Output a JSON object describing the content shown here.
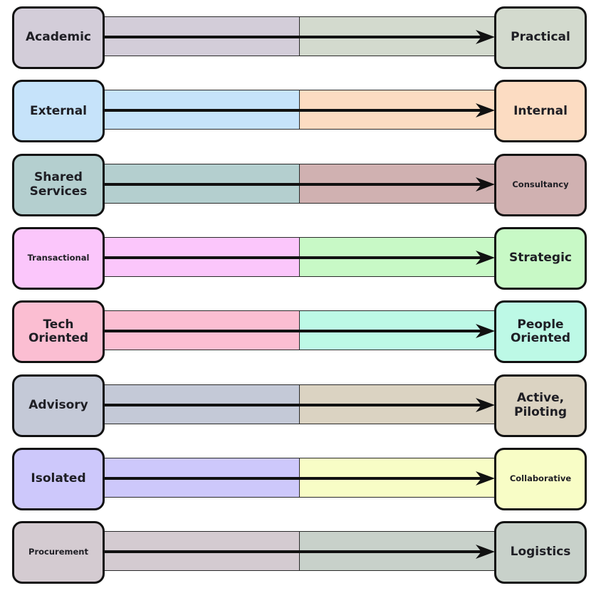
{
  "diagram": {
    "title": "",
    "spectra": [
      {
        "from": "Academic",
        "to": "Practical",
        "from_color": "#d3cdd9",
        "to_color": "#d3dace",
        "from_size": "lg",
        "to_size": "lg"
      },
      {
        "from": "External",
        "to": "Internal",
        "from_color": "#c6e3fa",
        "to_color": "#fcdcc2",
        "from_size": "lg",
        "to_size": "lg"
      },
      {
        "from": "Shared Services",
        "to": "Consultancy",
        "from_color": "#b4cfcf",
        "to_color": "#d0b1b1",
        "from_size": "lg",
        "to_size": "sm"
      },
      {
        "from": "Transactional",
        "to": "Strategic",
        "from_color": "#fbc6fb",
        "to_color": "#c8f9c6",
        "from_size": "sm",
        "to_size": "lg"
      },
      {
        "from": "Tech Oriented",
        "to": "People Oriented",
        "from_color": "#fbbed2",
        "to_color": "#bdf9e6",
        "from_size": "lg",
        "to_size": "lg"
      },
      {
        "from": "Advisory",
        "to": "Active, Piloting",
        "from_color": "#c4c9d7",
        "to_color": "#dbd3c2",
        "from_size": "lg",
        "to_size": "lg"
      },
      {
        "from": "Isolated",
        "to": "Collaborative",
        "from_color": "#cdc8fb",
        "to_color": "#f8fdc6",
        "from_size": "lg",
        "to_size": "sm"
      },
      {
        "from": "Procurement",
        "to": "Logistics",
        "from_color": "#d4cbd1",
        "to_color": "#c8d1ca",
        "from_size": "sm",
        "to_size": "lg"
      }
    ]
  }
}
